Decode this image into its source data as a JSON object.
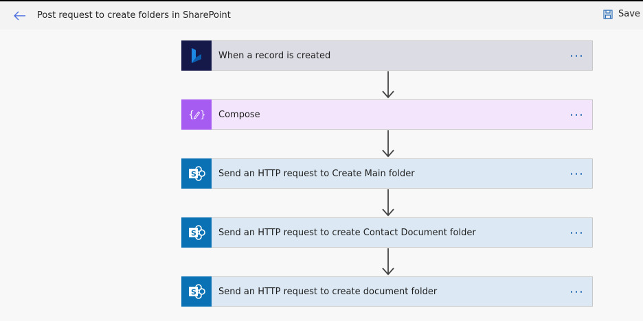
{
  "header": {
    "title": "Post request to create folders in SharePoint",
    "save_label": "Save"
  },
  "steps": [
    {
      "label": "When a record is created",
      "icon": "dynamics-icon"
    },
    {
      "label": "Compose",
      "icon": "compose-icon"
    },
    {
      "label": "Send an HTTP request to Create Main folder",
      "icon": "sharepoint-icon"
    },
    {
      "label": "Send an HTTP request to create Contact Document folder",
      "icon": "sharepoint-icon"
    },
    {
      "label": "Send an HTTP request to create document folder",
      "icon": "sharepoint-icon"
    }
  ],
  "colors": {
    "accent": "#2b6cb6",
    "trigger_tile": "#14194a",
    "compose_tile": "#a65cf0",
    "sharepoint_tile": "#0a72b4"
  }
}
